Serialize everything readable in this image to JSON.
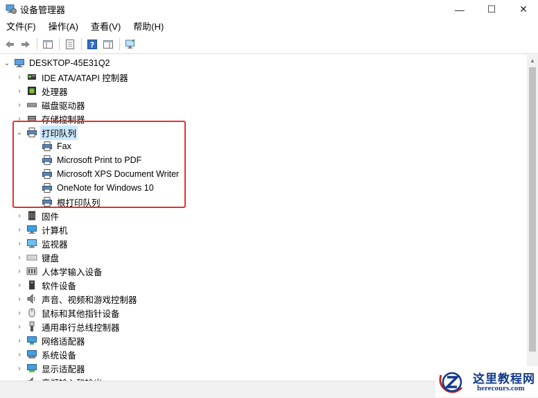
{
  "window": {
    "title": "设备管理器",
    "minimize_glyph": "—",
    "maximize_glyph": "☐",
    "close_glyph": "✕"
  },
  "menu": [
    "文件(F)",
    "操作(A)",
    "查看(V)",
    "帮助(H)"
  ],
  "toolbar": {
    "buttons": [
      "back-icon",
      "forward-icon",
      "properties-list-icon",
      "update-driver-icon",
      "help-icon",
      "details-icon",
      "scan-monitor-icon"
    ]
  },
  "tree": {
    "root": {
      "label": "DESKTOP-45E31Q2",
      "expanded": true
    },
    "categories": [
      {
        "label": "IDE ATA/ATAPI 控制器",
        "icon": "ide-controller-icon",
        "expanded": false
      },
      {
        "label": "处理器",
        "icon": "processor-icon",
        "expanded": false
      },
      {
        "label": "磁盘驱动器",
        "icon": "disk-drive-icon",
        "expanded": false
      },
      {
        "label": "存储控制器",
        "icon": "storage-controller-icon",
        "expanded": false
      },
      {
        "label": "打印队列",
        "icon": "printer-icon",
        "expanded": true,
        "selected": true,
        "children": [
          {
            "label": "Fax",
            "icon": "printer-icon"
          },
          {
            "label": "Microsoft Print to PDF",
            "icon": "printer-icon"
          },
          {
            "label": "Microsoft XPS Document Writer",
            "icon": "printer-icon"
          },
          {
            "label": "OneNote for Windows 10",
            "icon": "printer-icon"
          },
          {
            "label": "根打印队列",
            "icon": "printer-icon"
          }
        ]
      },
      {
        "label": "固件",
        "icon": "firmware-icon",
        "expanded": false
      },
      {
        "label": "计算机",
        "icon": "computer-icon",
        "expanded": false
      },
      {
        "label": "监视器",
        "icon": "monitor-icon",
        "expanded": false
      },
      {
        "label": "键盘",
        "icon": "keyboard-icon",
        "expanded": false
      },
      {
        "label": "人体学输入设备",
        "icon": "hid-icon",
        "expanded": false
      },
      {
        "label": "软件设备",
        "icon": "software-device-icon",
        "expanded": false
      },
      {
        "label": "声音、视频和游戏控制器",
        "icon": "audio-icon",
        "expanded": false
      },
      {
        "label": "鼠标和其他指针设备",
        "icon": "mouse-icon",
        "expanded": false
      },
      {
        "label": "通用串行总线控制器",
        "icon": "usb-icon",
        "expanded": false
      },
      {
        "label": "网络适配器",
        "icon": "network-adapter-icon",
        "expanded": false
      },
      {
        "label": "系统设备",
        "icon": "system-device-icon",
        "expanded": false
      },
      {
        "label": "显示适配器",
        "icon": "display-adapter-icon",
        "expanded": false
      },
      {
        "label": "音频输入和输出",
        "icon": "audio-io-icon",
        "expanded": false
      }
    ]
  },
  "watermark": {
    "title": "这里教程网",
    "url": "herecours.com"
  },
  "colors": {
    "highlight_box": "#e0322c",
    "selection": "#cce8ff",
    "watermark": "#123a8a"
  }
}
